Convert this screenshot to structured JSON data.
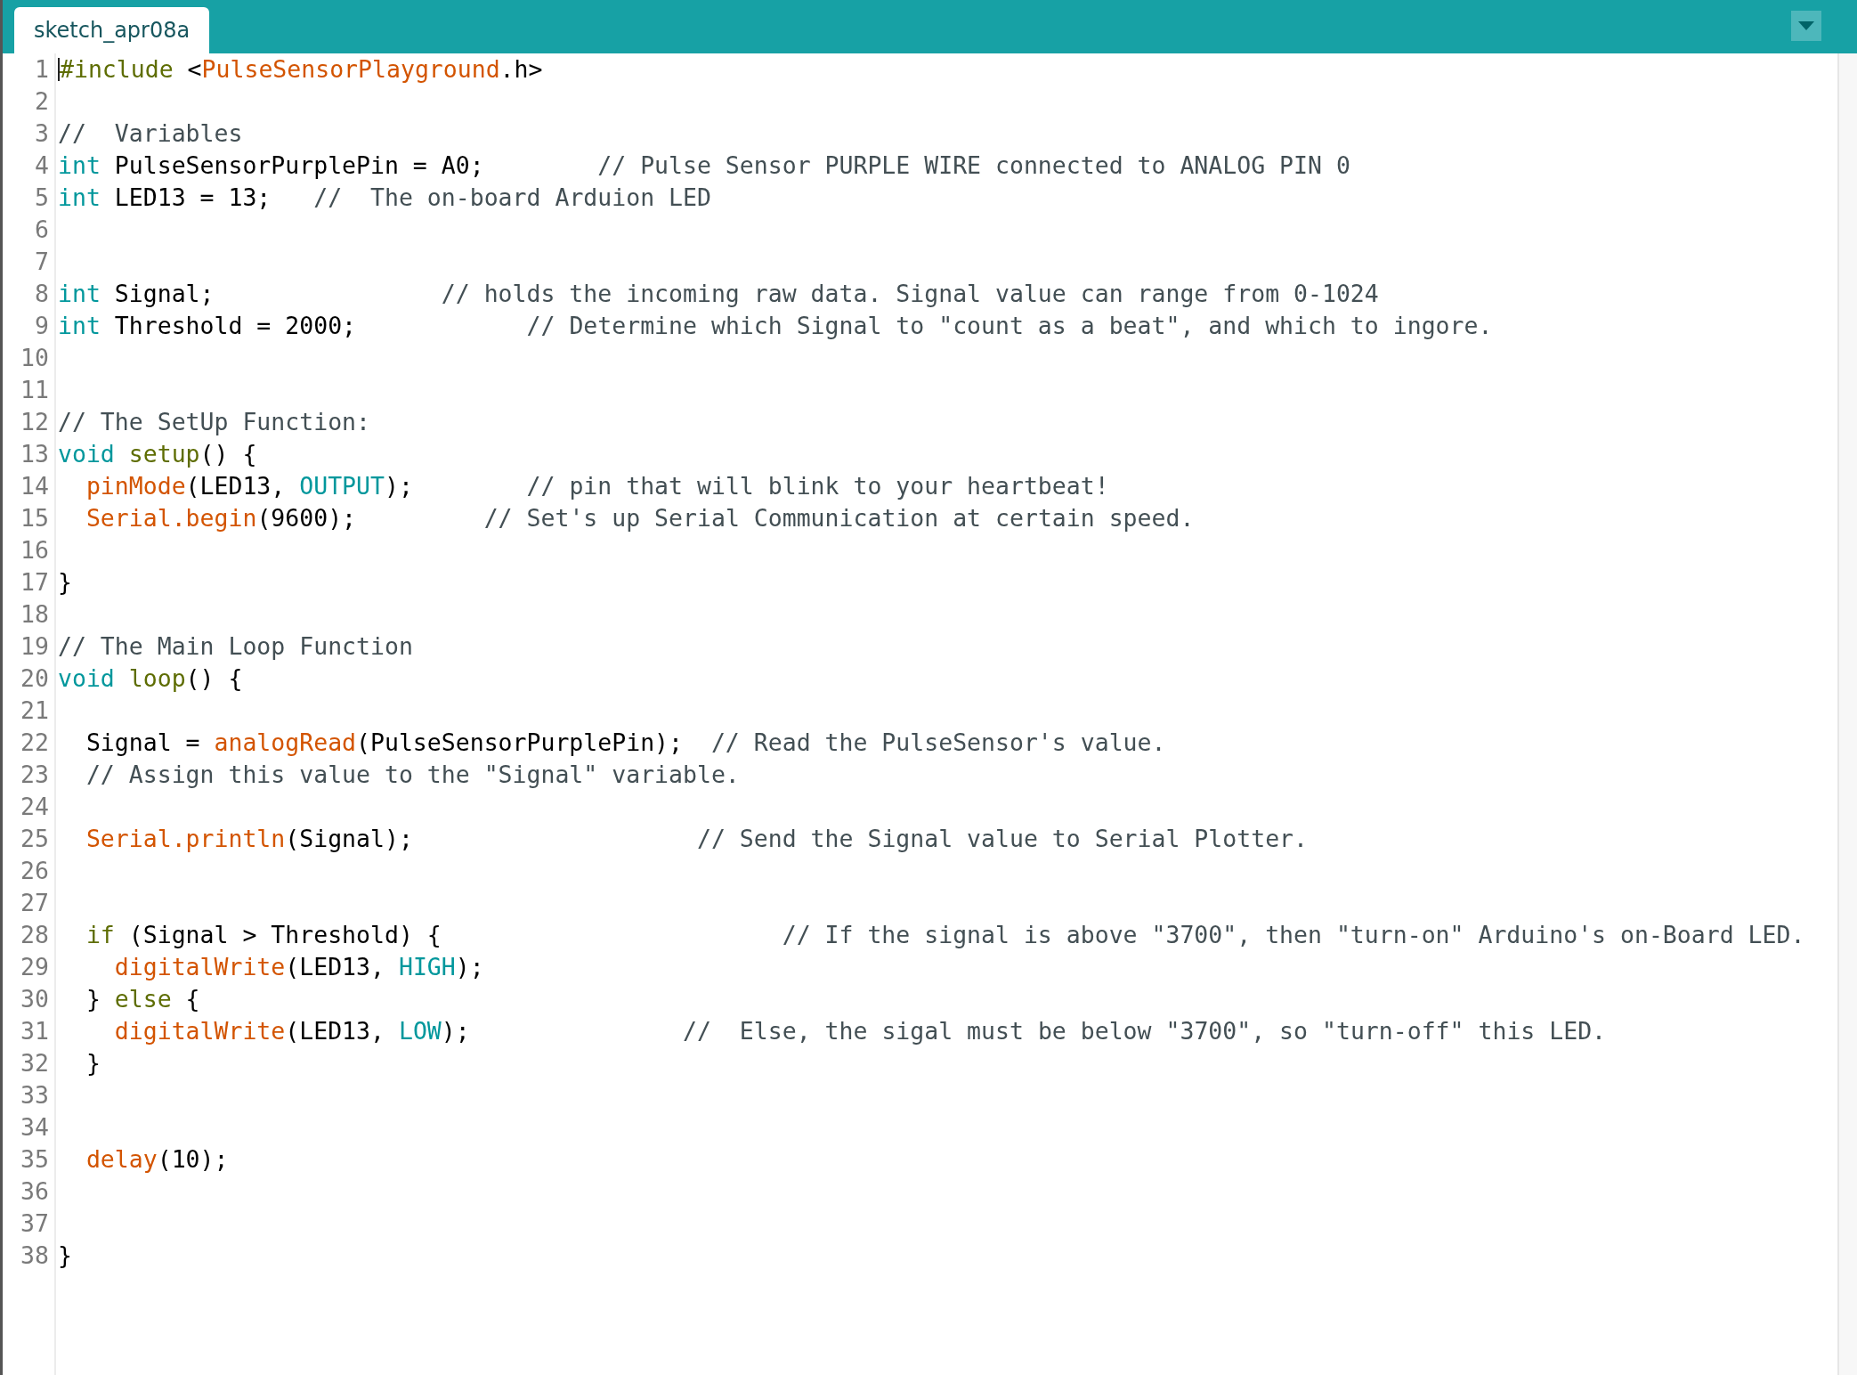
{
  "tab": {
    "title": "sketch_apr08a",
    "selected": true
  },
  "code": {
    "lines": [
      {
        "number": "1",
        "tokens": [
          {
            "text": "#include",
            "kind": "keyword"
          },
          {
            "text": " <",
            "kind": "plain"
          },
          {
            "text": "PulseSensorPlayground",
            "kind": "function"
          },
          {
            "text": ".h>",
            "kind": "plain"
          }
        ]
      },
      {
        "number": "2"
      },
      {
        "number": "3",
        "tokens": [
          {
            "text": "//  Variables",
            "kind": "comment"
          }
        ]
      },
      {
        "number": "4",
        "tokens": [
          {
            "text": "int",
            "kind": "type"
          },
          {
            "text": " PulseSensorPurplePin = A0;        ",
            "kind": "plain"
          },
          {
            "text": "// Pulse Sensor PURPLE WIRE connected to ANALOG PIN 0",
            "kind": "comment"
          }
        ]
      },
      {
        "number": "5",
        "tokens": [
          {
            "text": "int",
            "kind": "type"
          },
          {
            "text": " LED13 = 13;   ",
            "kind": "plain"
          },
          {
            "text": "//  The on-board Arduion LED",
            "kind": "comment"
          }
        ]
      },
      {
        "number": "6"
      },
      {
        "number": "7"
      },
      {
        "number": "8",
        "tokens": [
          {
            "text": "int",
            "kind": "type"
          },
          {
            "text": " Signal;                ",
            "kind": "plain"
          },
          {
            "text": "// holds the incoming raw data. Signal value can range from 0-1024",
            "kind": "comment"
          }
        ]
      },
      {
        "number": "9",
        "tokens": [
          {
            "text": "int",
            "kind": "type"
          },
          {
            "text": " Threshold = 2000;            ",
            "kind": "plain"
          },
          {
            "text": "// Determine which Signal to \"count as a beat\", and which to ingore.",
            "kind": "comment"
          }
        ]
      },
      {
        "number": "10"
      },
      {
        "number": "11"
      },
      {
        "number": "12",
        "tokens": [
          {
            "text": "// The SetUp Function:",
            "kind": "comment"
          }
        ]
      },
      {
        "number": "13",
        "tokens": [
          {
            "text": "void ",
            "kind": "type"
          },
          {
            "text": "setup",
            "kind": "keyword"
          },
          {
            "text": "() {",
            "kind": "plain"
          }
        ]
      },
      {
        "number": "14",
        "tokens": [
          {
            "text": "  pinMode",
            "kind": "function"
          },
          {
            "text": "(LED13, ",
            "kind": "plain"
          },
          {
            "text": "OUTPUT",
            "kind": "constant"
          },
          {
            "text": ");        ",
            "kind": "plain"
          },
          {
            "text": "// pin that will blink to your heartbeat!",
            "kind": "comment"
          }
        ]
      },
      {
        "number": "15",
        "tokens": [
          {
            "text": "  Serial.begin",
            "kind": "function"
          },
          {
            "text": "(9600);         ",
            "kind": "plain"
          },
          {
            "text": "// Set's up Serial Communication at certain speed.",
            "kind": "comment"
          }
        ]
      },
      {
        "number": "16"
      },
      {
        "number": "17",
        "tokens": [
          {
            "text": "}",
            "kind": "plain"
          }
        ]
      },
      {
        "number": "18"
      },
      {
        "number": "19",
        "tokens": [
          {
            "text": "// The Main Loop Function",
            "kind": "comment"
          }
        ]
      },
      {
        "number": "20",
        "tokens": [
          {
            "text": "void ",
            "kind": "type"
          },
          {
            "text": "loop",
            "kind": "keyword"
          },
          {
            "text": "() {",
            "kind": "plain"
          }
        ]
      },
      {
        "number": "21"
      },
      {
        "number": "22",
        "tokens": [
          {
            "text": "  Signal = ",
            "kind": "plain"
          },
          {
            "text": "analogRead",
            "kind": "function"
          },
          {
            "text": "(PulseSensorPurplePin);  ",
            "kind": "plain"
          },
          {
            "text": "// Read the PulseSensor's value.",
            "kind": "comment"
          }
        ]
      },
      {
        "number": "23",
        "tokens": [
          {
            "text": "  // Assign this value to the \"Signal\" variable.",
            "kind": "comment"
          }
        ]
      },
      {
        "number": "24"
      },
      {
        "number": "25",
        "tokens": [
          {
            "text": "  Serial.println",
            "kind": "function"
          },
          {
            "text": "(Signal);                    ",
            "kind": "plain"
          },
          {
            "text": "// Send the Signal value to Serial Plotter.",
            "kind": "comment"
          }
        ]
      },
      {
        "number": "26"
      },
      {
        "number": "27"
      },
      {
        "number": "28",
        "tokens": [
          {
            "text": "  if",
            "kind": "keyword"
          },
          {
            "text": " (Signal > Threshold) {                        ",
            "kind": "plain"
          },
          {
            "text": "// If the signal is above \"3700\", then \"turn-on\" Arduino's on-Board LED.",
            "kind": "comment"
          }
        ]
      },
      {
        "number": "29",
        "tokens": [
          {
            "text": "    digitalWrite",
            "kind": "function"
          },
          {
            "text": "(LED13, ",
            "kind": "plain"
          },
          {
            "text": "HIGH",
            "kind": "constant"
          },
          {
            "text": ");",
            "kind": "plain"
          }
        ]
      },
      {
        "number": "30",
        "tokens": [
          {
            "text": "  } ",
            "kind": "plain"
          },
          {
            "text": "else",
            "kind": "keyword"
          },
          {
            "text": " {",
            "kind": "plain"
          }
        ]
      },
      {
        "number": "31",
        "tokens": [
          {
            "text": "    digitalWrite",
            "kind": "function"
          },
          {
            "text": "(LED13, ",
            "kind": "plain"
          },
          {
            "text": "LOW",
            "kind": "constant"
          },
          {
            "text": ");               ",
            "kind": "plain"
          },
          {
            "text": "//  Else, the sigal must be below \"3700\", so \"turn-off\" this LED.",
            "kind": "comment"
          }
        ]
      },
      {
        "number": "32",
        "tokens": [
          {
            "text": "  }",
            "kind": "plain"
          }
        ]
      },
      {
        "number": "33"
      },
      {
        "number": "34"
      },
      {
        "number": "35",
        "tokens": [
          {
            "text": "  delay",
            "kind": "function"
          },
          {
            "text": "(10);",
            "kind": "plain"
          }
        ]
      },
      {
        "number": "36"
      },
      {
        "number": "37"
      },
      {
        "number": "38",
        "tokens": [
          {
            "text": "}",
            "kind": "plain"
          }
        ]
      }
    ]
  }
}
